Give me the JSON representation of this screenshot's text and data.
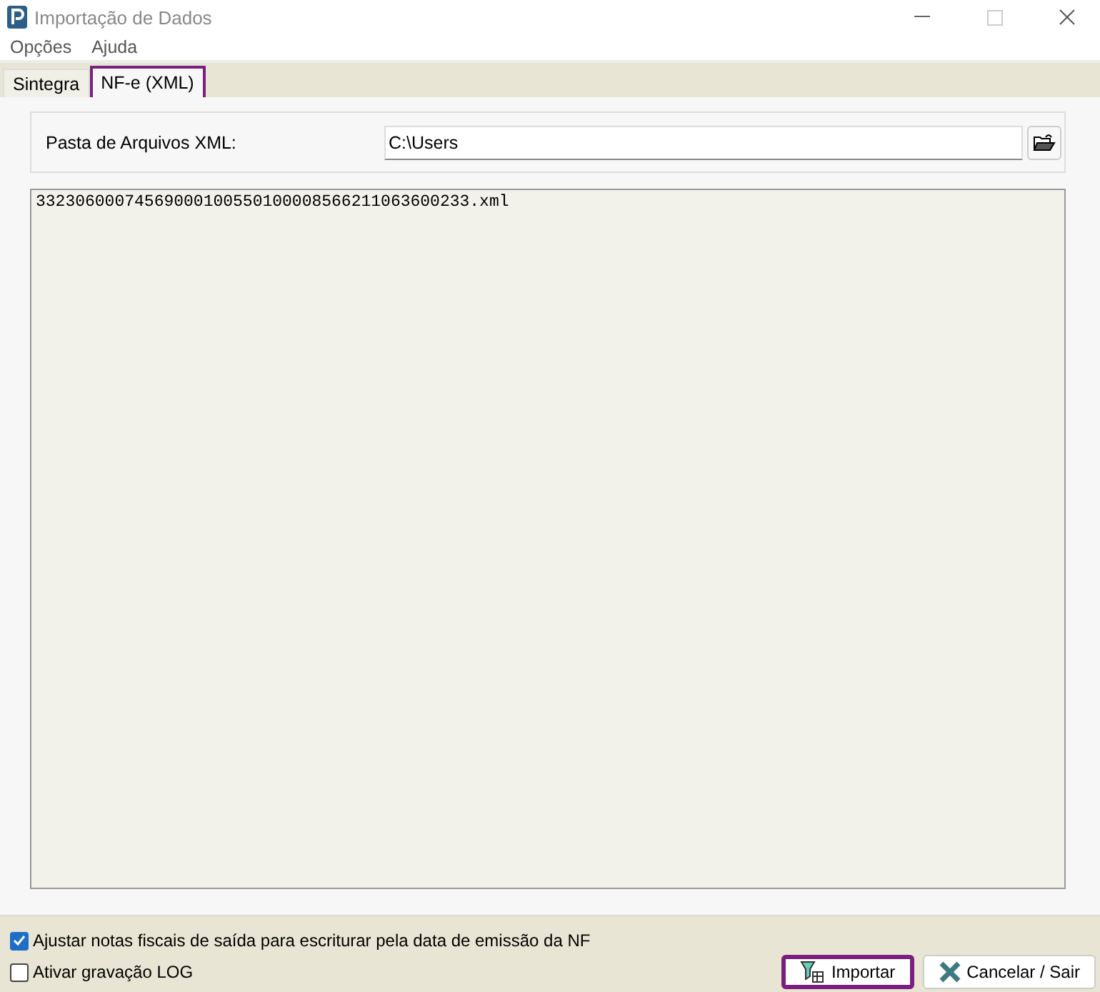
{
  "window": {
    "title": "Importação de Dados"
  },
  "menu": [
    "Opções",
    "Ajuda"
  ],
  "tabs": [
    {
      "label": "Sintegra",
      "selected": false,
      "highlighted": false
    },
    {
      "label": "NF-e (XML)",
      "selected": true,
      "highlighted": true
    }
  ],
  "folder": {
    "label": "Pasta de Arquivos XML:",
    "value": "C:\\Users"
  },
  "files": [
    "33230600074569000100550100008566211063600233.xml"
  ],
  "options": [
    {
      "label": "Ajustar notas fiscais de saída para escriturar pela data de emissão da NF",
      "checked": true
    },
    {
      "label": "Ativar gravação LOG",
      "checked": false
    }
  ],
  "buttons": [
    {
      "kind": "import",
      "label": "Importar",
      "highlighted": true
    },
    {
      "kind": "cancel",
      "label": "Cancelar / Sair",
      "highlighted": false
    }
  ]
}
